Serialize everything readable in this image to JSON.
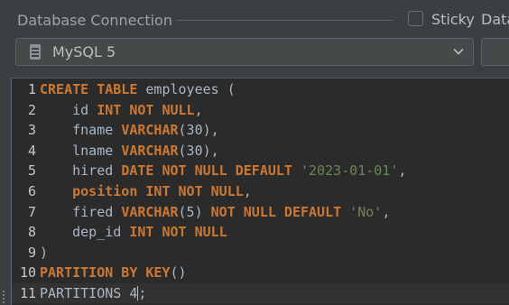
{
  "header": {
    "title": "Database Connection",
    "sticky_label": "Sticky",
    "truncated_label": "Data"
  },
  "connection": {
    "selected": "MySQL 5",
    "icon": "database-icon"
  },
  "editor": {
    "lines": [
      {
        "number": "1",
        "tokens": [
          {
            "t": "kw",
            "v": "CREATE TABLE"
          },
          {
            "t": "id",
            "v": " employees ("
          }
        ]
      },
      {
        "number": "2",
        "tokens": [
          {
            "t": "id",
            "v": "    id "
          },
          {
            "t": "kw",
            "v": "INT NOT NULL"
          },
          {
            "t": "punc",
            "v": ","
          }
        ]
      },
      {
        "number": "3",
        "tokens": [
          {
            "t": "id",
            "v": "    fname "
          },
          {
            "t": "kw",
            "v": "VARCHAR"
          },
          {
            "t": "punc",
            "v": "(30),"
          }
        ]
      },
      {
        "number": "4",
        "tokens": [
          {
            "t": "id",
            "v": "    lname "
          },
          {
            "t": "kw",
            "v": "VARCHAR"
          },
          {
            "t": "punc",
            "v": "(30),"
          }
        ]
      },
      {
        "number": "5",
        "tokens": [
          {
            "t": "id",
            "v": "    hired "
          },
          {
            "t": "kw",
            "v": "DATE NOT NULL DEFAULT"
          },
          {
            "t": "id",
            "v": " "
          },
          {
            "t": "str",
            "v": "'2023-01-01'"
          },
          {
            "t": "punc",
            "v": ","
          }
        ]
      },
      {
        "number": "6",
        "tokens": [
          {
            "t": "id",
            "v": "    "
          },
          {
            "t": "kw",
            "v": "position INT NOT NULL"
          },
          {
            "t": "punc",
            "v": ","
          }
        ]
      },
      {
        "number": "7",
        "tokens": [
          {
            "t": "id",
            "v": "    fired "
          },
          {
            "t": "kw",
            "v": "VARCHAR"
          },
          {
            "t": "punc",
            "v": "(5) "
          },
          {
            "t": "kw",
            "v": "NOT NULL DEFAULT"
          },
          {
            "t": "id",
            "v": " "
          },
          {
            "t": "str",
            "v": "'No'"
          },
          {
            "t": "punc",
            "v": ","
          }
        ]
      },
      {
        "number": "8",
        "tokens": [
          {
            "t": "id",
            "v": "    dep_id "
          },
          {
            "t": "kw",
            "v": "INT NOT NULL"
          }
        ]
      },
      {
        "number": "9",
        "tokens": [
          {
            "t": "punc",
            "v": ")"
          }
        ]
      },
      {
        "number": "10",
        "tokens": [
          {
            "t": "kw",
            "v": "PARTITION BY KEY"
          },
          {
            "t": "punc",
            "v": "()"
          }
        ]
      },
      {
        "number": "11",
        "tokens": [
          {
            "t": "id",
            "v": "PARTITIONS 4"
          },
          {
            "t": "caret",
            "v": ""
          },
          {
            "t": "punc",
            "v": ";"
          }
        ],
        "current": true
      }
    ]
  },
  "colors": {
    "keyword": "#cc7832",
    "string": "#6a8759",
    "identifier": "#a9b7c6",
    "editor_bg": "#2b2b2b",
    "panel_bg": "#3c3f41"
  }
}
